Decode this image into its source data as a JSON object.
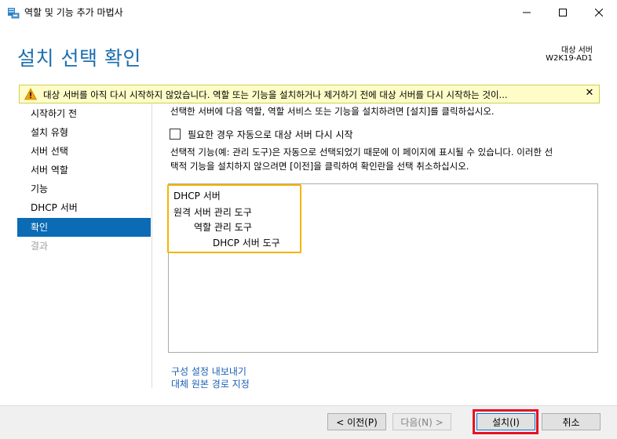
{
  "window": {
    "title": "역할 및 기능 추가 마법사",
    "minimize_glyph": "—",
    "maximize_glyph": "☐",
    "close_glyph": "✕"
  },
  "header": {
    "title": "설치 선택 확인",
    "server_label": "대상 서버",
    "server_name": "W2K19-AD1"
  },
  "warning": {
    "text": "대상 서버를 아직 다시 시작하지 않았습니다. 역할 또는 기능을 설치하거나 제거하기 전에 대상 서버를 다시 시작하는 것이...",
    "close_glyph": "✕",
    "accent": "#fefdc7"
  },
  "sidebar": {
    "items": [
      {
        "label": "시작하기 전"
      },
      {
        "label": "설치 유형"
      },
      {
        "label": "서버 선택"
      },
      {
        "label": "서버 역할"
      },
      {
        "label": "기능"
      },
      {
        "label": "DHCP 서버"
      },
      {
        "label": "확인"
      },
      {
        "label": "결과"
      }
    ],
    "active_index": 6,
    "active_color": "#0b6bb5"
  },
  "main": {
    "intro": "선택한 서버에 다음 역할, 역할 서비스 또는 기능을 설치하려면 [설치]를 클릭하십시오.",
    "restart_checkbox_label": "필요한 경우 자동으로 대상 서버 다시 시작",
    "note_line1": "선택적 기능(예: 관리 도구)은 자동으로 선택되었기 때문에 이 페이지에 표시될 수 있습니다. 이러한 선",
    "note_line2": "택적 기능을 설치하지 않으려면 [이전]을 클릭하여 확인란을 선택 취소하십시오.",
    "features": [
      {
        "label": "DHCP 서버",
        "level": 0
      },
      {
        "label": "원격 서버 관리 도구",
        "level": 0
      },
      {
        "label": "역할 관리 도구",
        "level": 1
      },
      {
        "label": "DHCP 서버 도구",
        "level": 2
      }
    ],
    "export_link": "구성 설정 내보내기",
    "alt_source_link": "대체 원본 경로 지정"
  },
  "footer": {
    "prev_label": "< 이전(P)",
    "next_label": "다음(N) >",
    "install_label": "설치(I)",
    "cancel_label": "취소"
  },
  "colors": {
    "title_blue": "#1b6fae",
    "highlight_orange": "#f5b300",
    "highlight_red": "#e81123"
  }
}
